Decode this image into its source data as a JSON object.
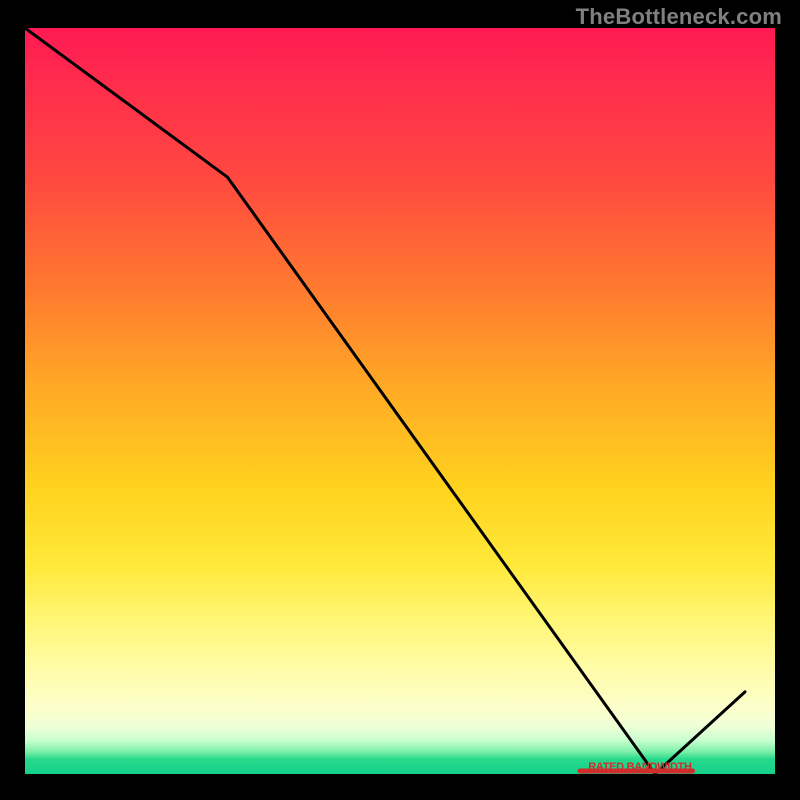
{
  "attribution": {
    "watermark": "TheBottleneck.com"
  },
  "chart_data": {
    "type": "line",
    "x": [
      0.0,
      0.27,
      0.84,
      0.96
    ],
    "values": [
      1.0,
      0.8,
      0.0,
      0.11
    ],
    "title": "",
    "xlabel": "",
    "ylabel": "",
    "xlim": [
      0,
      1
    ],
    "ylim": [
      0,
      1
    ],
    "background_gradient": {
      "stops": [
        {
          "pos": 0.0,
          "color": "#ff1a53"
        },
        {
          "pos": 0.35,
          "color": "#ff7a2f"
        },
        {
          "pos": 0.62,
          "color": "#ffd31e"
        },
        {
          "pos": 0.86,
          "color": "#fffca8"
        },
        {
          "pos": 0.97,
          "color": "#7cf0a8"
        },
        {
          "pos": 1.0,
          "color": "#14d08a"
        }
      ]
    },
    "baseline_segment": {
      "x0": 0.74,
      "x1": 0.89,
      "y": 0.0
    },
    "annotations": [
      {
        "key": "baseline_label",
        "text": "RATED BANDWIDTH"
      }
    ]
  },
  "colors": {
    "line": "#000000",
    "label": "#d12b2b",
    "watermark": "#808080"
  }
}
